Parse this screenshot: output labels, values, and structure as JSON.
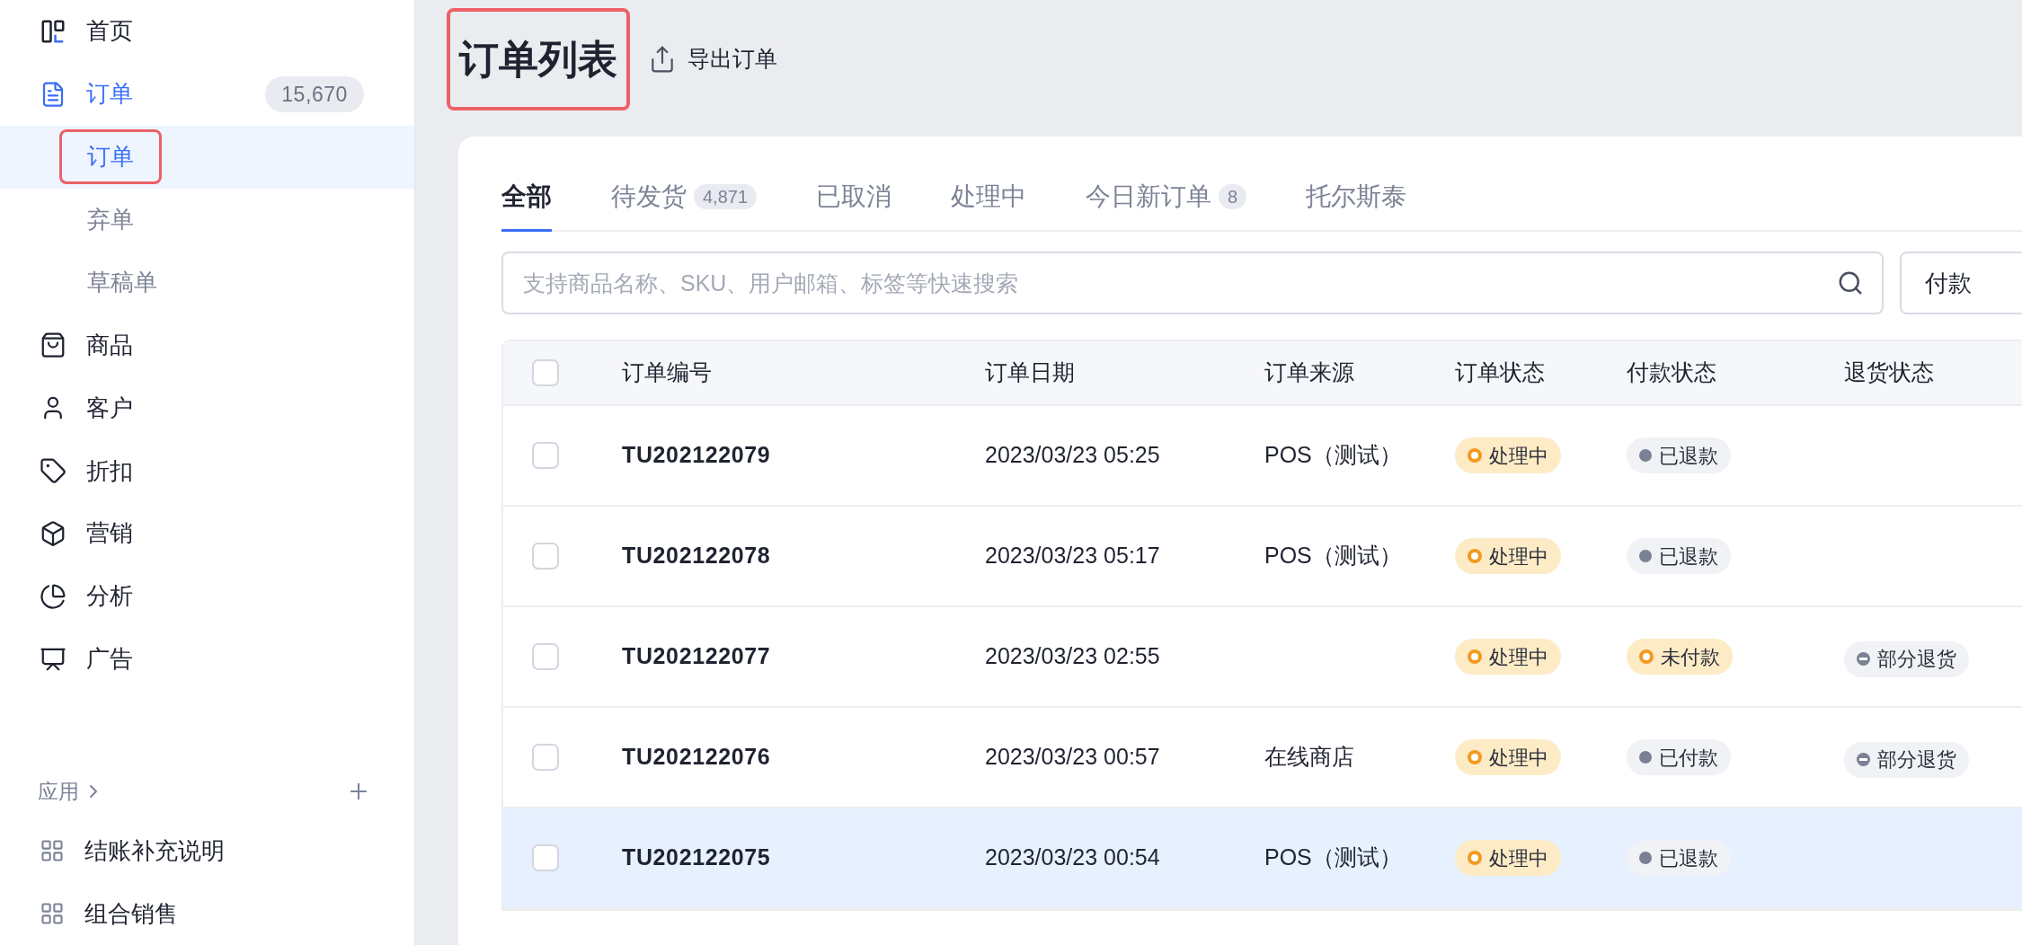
{
  "sidebar": {
    "items": [
      {
        "label": "首页",
        "active": false
      },
      {
        "label": "订单",
        "active": true,
        "count": "15,670",
        "children": [
          {
            "label": "订单",
            "selected": true,
            "annotated": true
          },
          {
            "label": "弃单",
            "selected": false,
            "annotated": false
          },
          {
            "label": "草稿单",
            "selected": false,
            "annotated": false
          }
        ]
      },
      {
        "label": "商品",
        "active": false
      },
      {
        "label": "客户",
        "active": false
      },
      {
        "label": "折扣",
        "active": false
      },
      {
        "label": "营销",
        "active": false
      },
      {
        "label": "分析",
        "active": false
      },
      {
        "label": "广告",
        "active": false
      }
    ],
    "apps": {
      "title": "应用",
      "items": [
        {
          "label": "结账补充说明"
        },
        {
          "label": "组合销售"
        }
      ]
    }
  },
  "header": {
    "title": "订单列表",
    "title_annotated": true,
    "export_label": "导出订单"
  },
  "tabs": [
    {
      "label": "全部",
      "selected": true
    },
    {
      "label": "待发货",
      "count": "4,871",
      "selected": false
    },
    {
      "label": "已取消",
      "selected": false
    },
    {
      "label": "处理中",
      "selected": false
    },
    {
      "label": "今日新订单",
      "count": "8",
      "selected": false
    },
    {
      "label": "托尔斯泰",
      "selected": false
    }
  ],
  "search": {
    "placeholder": "支持商品名称、SKU、用户邮箱、标签等快速搜索"
  },
  "filter_button": "付款",
  "table": {
    "header_checked": false,
    "columns": [
      "订单编号",
      "订单日期",
      "订单来源",
      "订单状态",
      "付款状态",
      "退货状态"
    ],
    "rows": [
      {
        "checked": false,
        "highlighted": false,
        "order_no": "TU202122079",
        "date": "2023/03/23 05:25",
        "source": "POS（测试）",
        "order_status": {
          "text": "处理中",
          "kind": "warning"
        },
        "payment_status": {
          "text": "已退款",
          "kind": "neutral"
        }
      },
      {
        "checked": false,
        "highlighted": false,
        "order_no": "TU202122078",
        "date": "2023/03/23 05:17",
        "source": "POS（测试）",
        "order_status": {
          "text": "处理中",
          "kind": "warning"
        },
        "payment_status": {
          "text": "已退款",
          "kind": "neutral"
        }
      },
      {
        "checked": false,
        "highlighted": false,
        "order_no": "TU202122077",
        "date": "2023/03/23 02:55",
        "order_status": {
          "text": "处理中",
          "kind": "warning"
        },
        "payment_status": {
          "text": "未付款",
          "kind": "warning"
        },
        "return_status": {
          "text": "部分退货",
          "kind": "neutral"
        }
      },
      {
        "checked": false,
        "highlighted": false,
        "order_no": "TU202122076",
        "date": "2023/03/23 00:57",
        "source": "在线商店",
        "order_status": {
          "text": "处理中",
          "kind": "warning"
        },
        "payment_status": {
          "text": "已付款",
          "kind": "neutral"
        },
        "return_status": {
          "text": "部分退货",
          "kind": "neutral"
        }
      },
      {
        "checked": false,
        "highlighted": true,
        "order_no": "TU202122075",
        "date": "2023/03/23 00:54",
        "source": "POS（测试）",
        "order_status": {
          "text": "处理中",
          "kind": "warning"
        },
        "payment_status": {
          "text": "已退款",
          "kind": "neutral"
        }
      }
    ]
  }
}
